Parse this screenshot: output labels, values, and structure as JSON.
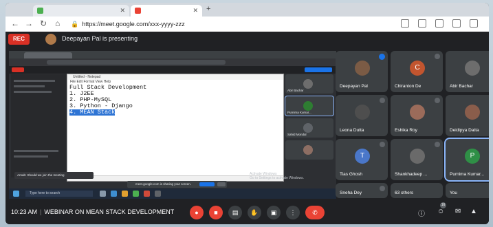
{
  "browser": {
    "tab1_title": "",
    "tab2_title": "",
    "url": "https://meet.google.com/xxx-yyyy-zzz",
    "new_tab": "+"
  },
  "meeting": {
    "rec_label": "REC",
    "presenter_text": "Deepayan Pal is presenting",
    "time": "10:23 AM",
    "title": "WEBINAR ON MEAN STACK DEVELOPMENT",
    "raise_badge": "16"
  },
  "notepad": {
    "title": "Untitled - Notepad",
    "menu": "File  Edit  Format  View  Help",
    "lines": [
      "Full Stack Development",
      "1. J2EE",
      "2. PHP-MySQL",
      "3. Python - Django"
    ],
    "selected_line": "4. MEAN Stack"
  },
  "shared_screen": {
    "chat_text": "Arnab: Should we join the meeting",
    "share_banner": "meet.google.com is sharing your screen.",
    "stop_label": "Stop sharing",
    "hide_label": "Hide",
    "activate": "Activate Windows",
    "activate_sub": "Go to Settings to activate Windows.",
    "search_placeholder": "Type here to search"
  },
  "shared_thumbs": [
    {
      "name": "Abir Bachar",
      "color": "#6d6d6d"
    },
    {
      "name": "Purnima Kumar...",
      "color": "#2e7d32"
    },
    {
      "name": "Sahid Mondal",
      "color": "#5f6368"
    },
    {
      "name": "",
      "color": "#8d6e63"
    }
  ],
  "participants": [
    {
      "name": "Deepayan Pal",
      "initial": "",
      "color": "#7b5b45",
      "speaking": true
    },
    {
      "name": "Chiranton De",
      "initial": "C",
      "color": "#c2552f",
      "speaking": false
    },
    {
      "name": "Abir Bachar",
      "initial": "",
      "color": "#6d6d6d",
      "speaking": false
    },
    {
      "name": "Leona Dutta",
      "initial": "",
      "color": "#4e4e4e",
      "speaking": false
    },
    {
      "name": "Eshika Roy",
      "initial": "",
      "color": "#9b6b5a",
      "speaking": false
    },
    {
      "name": "Deidipya Datta",
      "initial": "",
      "color": "#8a5d4b",
      "speaking": false
    },
    {
      "name": "Tias Ghosh",
      "initial": "T",
      "color": "#4a77c9",
      "speaking": false
    },
    {
      "name": "Shankhadeep ...",
      "initial": "",
      "color": "#6a6a6a",
      "speaking": false
    },
    {
      "name": "Purnima Kumar...",
      "initial": "P",
      "color": "#2f8f46",
      "speaking": false
    },
    {
      "name": "Sneha Dey",
      "initial": "",
      "color": "#8e7a6a",
      "speaking": false
    },
    {
      "name": "63 others",
      "initial": "",
      "color": "#7a5f52",
      "speaking": false
    },
    {
      "name": "You",
      "initial": "",
      "color": "#a87f6b",
      "speaking": false
    }
  ],
  "colors": {
    "accent": "#1a73e8",
    "end_call": "#ea4335",
    "tile_bg": "#3c4043",
    "selection": "#2e74d4"
  }
}
